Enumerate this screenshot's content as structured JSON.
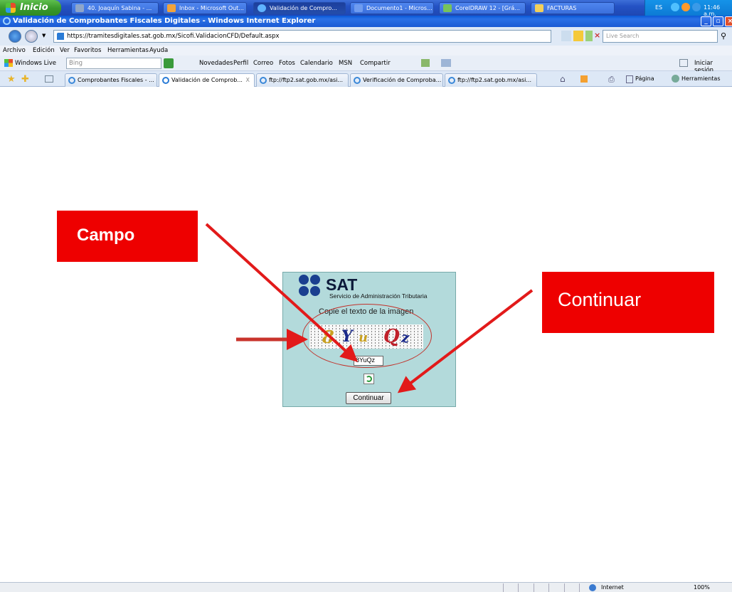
{
  "taskbar": {
    "start_label": "Inicio",
    "buttons": [
      {
        "label": "40. Joaquín Sabina - ...",
        "color": "#8fa6c9"
      },
      {
        "label": "Inbox - Microsoft Out...",
        "color": "#f2a33a"
      },
      {
        "label": "Validación de Compro...",
        "color": "#5fb3ff"
      },
      {
        "label": "Documento1 - Micros...",
        "color": "#6f9cf0"
      },
      {
        "label": "CorelDRAW 12 - [Grá...",
        "color": "#77c35b"
      },
      {
        "label": "FACTURAS",
        "color": "#f2cf5a"
      }
    ],
    "tray": {
      "lang": "ES",
      "time": "11:46 a.m."
    }
  },
  "window": {
    "title": "Validación de Comprobantes Fiscales Digitales - Windows Internet Explorer"
  },
  "address": {
    "url": "https://tramitesdigitales.sat.gob.mx/Sicofi.ValidacionCFD/Default.aspx",
    "search_placeholder": "Live Search"
  },
  "menu": [
    "Archivo",
    "Edición",
    "Ver",
    "Favoritos",
    "Herramientas",
    "Ayuda"
  ],
  "livebar": {
    "brand": "Windows Live",
    "search_placeholder": "Bing",
    "links": [
      "Novedades",
      "Perfil",
      "Correo",
      "Fotos",
      "Calendario",
      "MSN",
      "Compartir"
    ],
    "signin": "Iniciar sesión"
  },
  "tabs": [
    {
      "label": "Comprobantes Fiscales - ..."
    },
    {
      "label": "Validación de Comprob...",
      "close": "X"
    },
    {
      "label": "ftp://ftp2.sat.gob.mx/asi..."
    },
    {
      "label": "Verificación de Comproba..."
    },
    {
      "label": "ftp://ftp2.sat.gob.mx/asi..."
    }
  ],
  "toolbar_right": {
    "page": "Página",
    "tools": "Herramientas"
  },
  "sat": {
    "title": "SAT",
    "subtitle": "Servicio de Administración Tributaria",
    "prompt": "Copie el texto de la imagen",
    "captcha_text": [
      "8",
      "Y",
      "u",
      "Q",
      "z"
    ],
    "input_value": "8YuQz",
    "continue_label": "Continuar"
  },
  "annotations": {
    "field_label": "Campo",
    "continue_label": "Continuar",
    "color": "#ee0000"
  },
  "status": {
    "zone": "Internet",
    "zoom": "100%"
  }
}
